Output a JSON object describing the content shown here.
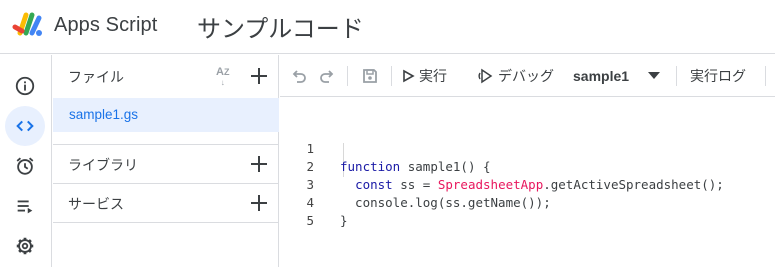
{
  "header": {
    "app_name": "Apps Script",
    "project_title": "サンプルコード"
  },
  "rail": {
    "items": [
      {
        "name": "overview",
        "icon": "info-icon",
        "active": false
      },
      {
        "name": "editor",
        "icon": "code-icon",
        "active": true
      },
      {
        "name": "triggers",
        "icon": "alarm-clock-icon",
        "active": false
      },
      {
        "name": "executions",
        "icon": "executions-list-icon",
        "active": false
      },
      {
        "name": "settings",
        "icon": "gear-icon",
        "active": false
      }
    ]
  },
  "panel": {
    "files_label": "ファイル",
    "sort_icon": "sort-az-icon",
    "files": [
      "sample1.gs"
    ],
    "libraries_label": "ライブラリ",
    "services_label": "サービス"
  },
  "toolbar": {
    "undo_icon": "undo-icon",
    "redo_icon": "redo-icon",
    "save_icon": "save-icon",
    "run_label": "実行",
    "debug_label": "デバッグ",
    "function_selected": "sample1",
    "log_label": "実行ログ"
  },
  "editor": {
    "lines": [
      {
        "n": "1",
        "text": "function sample1() {"
      },
      {
        "n": "2",
        "text": "  const ss = SpreadsheetApp.getActiveSpreadsheet();"
      },
      {
        "n": "3",
        "text": "  console.log(ss.getName());"
      },
      {
        "n": "4",
        "text": "}"
      },
      {
        "n": "5",
        "text": ""
      }
    ]
  },
  "colors": {
    "accent": "#1a73e8",
    "active_bg": "#e8f0fe",
    "border": "#dadce0",
    "keyword": "#1a1aa6",
    "class": "#e8175d"
  }
}
